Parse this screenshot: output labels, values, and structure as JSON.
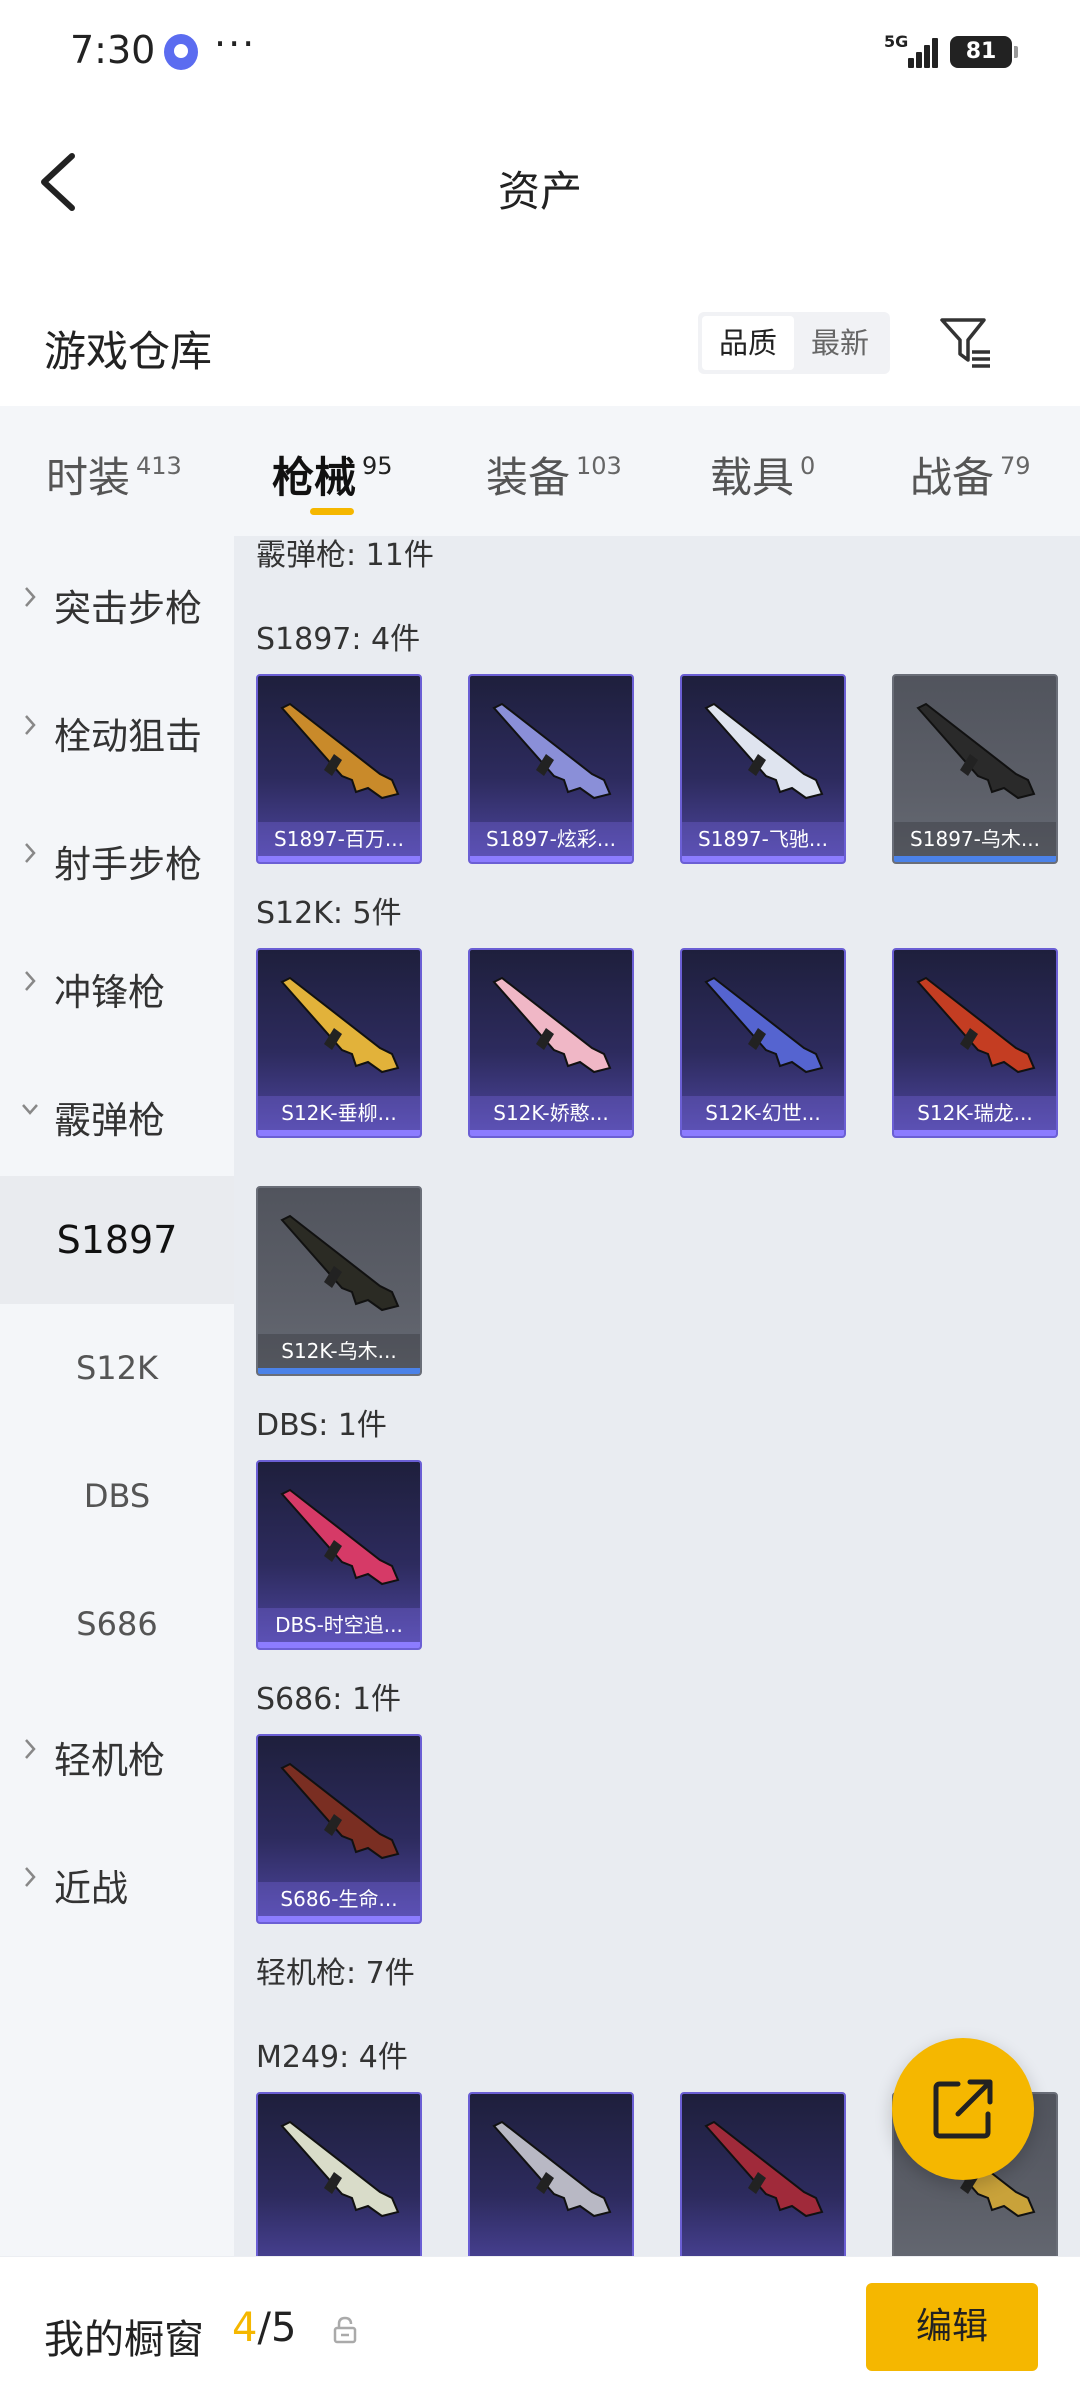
{
  "status_bar": {
    "time": "7:30",
    "app_icon": "app-notification-icon",
    "dots": "···",
    "network": "5G",
    "battery": "81"
  },
  "nav": {
    "back_icon": "back-arrow-icon",
    "title": "资产"
  },
  "warehouse": {
    "title": "游戏仓库",
    "sort_options": [
      "品质",
      "最新"
    ],
    "sort_selected": "品质",
    "filter_icon": "filter-icon"
  },
  "tabs": [
    {
      "label": "时装",
      "count": "413"
    },
    {
      "label": "枪械",
      "count": "95"
    },
    {
      "label": "装备",
      "count": "103"
    },
    {
      "label": "载具",
      "count": "0"
    },
    {
      "label": "战备",
      "count": "79"
    }
  ],
  "active_tab": "枪械",
  "sidebar": {
    "categories": [
      {
        "label": "突击步枪",
        "expanded": false
      },
      {
        "label": "栓动狙击",
        "expanded": false
      },
      {
        "label": "射手步枪",
        "expanded": false
      },
      {
        "label": "冲锋枪",
        "expanded": false
      },
      {
        "label": "霰弹枪",
        "expanded": true
      },
      {
        "label": "轻机枪",
        "expanded": false
      },
      {
        "label": "近战",
        "expanded": false
      }
    ],
    "sub_items": [
      "S1897",
      "S12K",
      "DBS",
      "S686"
    ],
    "active_sub": "S1897"
  },
  "content": {
    "top_partial": "霰弹枪: 11件",
    "groups": [
      {
        "label": "S1897: 4件",
        "items": [
          {
            "name": "S1897-百万...",
            "color": "#c98a2a"
          },
          {
            "name": "S1897-炫彩...",
            "color": "#8a8fd8"
          },
          {
            "name": "S1897-飞驰...",
            "color": "#dfe4ef"
          },
          {
            "name": "S1897-乌木...",
            "color": "#2a2a2a",
            "grey": true
          }
        ]
      },
      {
        "label": "S12K: 5件",
        "items": [
          {
            "name": "S12K-垂柳...",
            "color": "#e2b23a"
          },
          {
            "name": "S12K-娇憨...",
            "color": "#f0b7c6"
          },
          {
            "name": "S12K-幻世...",
            "color": "#5564d0"
          },
          {
            "name": "S12K-瑞龙...",
            "color": "#c43d22"
          },
          {
            "name": "S12K-乌木...",
            "color": "#2b2b24",
            "grey": true
          }
        ]
      },
      {
        "label": "DBS: 1件",
        "items": [
          {
            "name": "DBS-时空追...",
            "color": "#d63a67"
          }
        ]
      },
      {
        "label": "S686: 1件",
        "items": [
          {
            "name": "S686-生命...",
            "color": "#7a2e22"
          }
        ]
      }
    ],
    "lmg_label": "轻机枪: 7件",
    "m249_label": "M249: 4件",
    "m249_items": [
      {
        "name": "",
        "color": "#d9dcc9"
      },
      {
        "name": "",
        "color": "#b8b8c4"
      },
      {
        "name": "",
        "color": "#a02a3a"
      },
      {
        "name": "",
        "color": "#c9a23a",
        "grey": true
      }
    ]
  },
  "fab": {
    "icon": "share-icon"
  },
  "bottom": {
    "showcase_label": "我的橱窗",
    "current": "4",
    "separator": "/",
    "total": "5",
    "lock_icon": "lock-icon",
    "edit_label": "编辑"
  },
  "colors": {
    "accent": "#f5b700",
    "item_bg": "#2d2b5e",
    "item_border": "#6b5fd4"
  }
}
